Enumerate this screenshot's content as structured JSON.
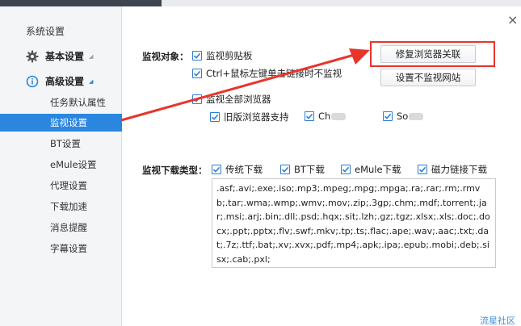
{
  "sidebar": {
    "title": "系统设置",
    "groups": [
      {
        "label": "基本设置",
        "icon": "gear-icon"
      },
      {
        "label": "高级设置",
        "icon": "info-icon"
      }
    ],
    "items": [
      "任务默认属性",
      "监视设置",
      "BT设置",
      "eMule设置",
      "代理设置",
      "下载加速",
      "消息提醒",
      "字幕设置"
    ],
    "active_item": "监视设置"
  },
  "monitor_object": {
    "label": "监视对象：",
    "options": {
      "clipboard": "监视剪贴板",
      "ctrl_click": "Ctrl+鼠标左键单击链接时不监视",
      "all_browsers": "监视全部浏览器",
      "legacy_browser": "旧版浏览器支持",
      "chrome_partial": "Ch",
      "other_partial": "So"
    }
  },
  "buttons": {
    "repair_browser": "修复浏览器关联",
    "no_monitor_site": "设置不监视网站"
  },
  "download_types": {
    "label": "监视下载类型：",
    "options": {
      "traditional": "传统下载",
      "bt": "BT下载",
      "emule": "eMule下载",
      "magnet": "磁力链接下载"
    },
    "extensions": ".asf;.avi;.exe;.iso;.mp3;.mpeg;.mpg;.mpga;.ra;.rar;.rm;.rmvb;.tar;.wma;.wmp;.wmv;.mov;.zip;.3gp;.chm;.mdf;.torrent;.jar;.msi;.arj;.bin;.dll;.psd;.hqx;.sit;.lzh;.gz;.tgz;.xlsx;.xls;.doc;.docx;.ppt;.pptx;.flv;.swf;.mkv;.tp;.ts;.flac;.ape;.wav;.aac;.txt;.dat;.7z;.ttf;.bat;.xv;.xvx;.pdf;.mp4;.apk;.ipa;.epub;.mobi;.deb;.sisx;.cab;.pxl;"
  },
  "close_glyph": "×",
  "watermark": "流星社区",
  "colors": {
    "accent": "#2b86e0",
    "annotation": "#e8352c"
  }
}
